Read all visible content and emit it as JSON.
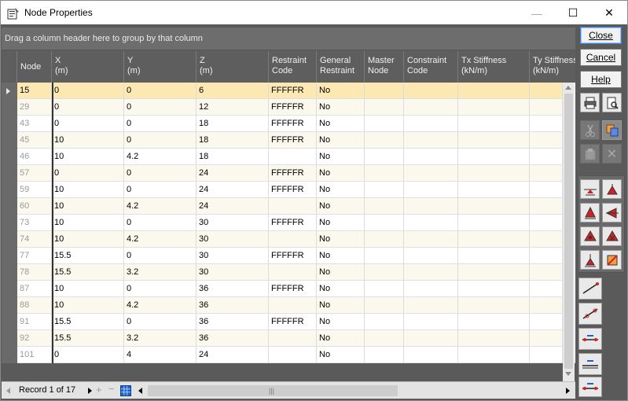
{
  "window": {
    "title": "Node Properties",
    "minimize_glyph": "—",
    "maximize_glyph": "☐",
    "close_glyph": "✕"
  },
  "grid": {
    "group_panel_text": "Drag a column header here to group by that column",
    "columns": [
      {
        "label": "Node",
        "unit": ""
      },
      {
        "label": "X",
        "unit": "(m)"
      },
      {
        "label": "Y",
        "unit": "(m)"
      },
      {
        "label": "Z",
        "unit": "(m)"
      },
      {
        "label": "Restraint",
        "unit": "Code"
      },
      {
        "label": "General",
        "unit": "Restraint"
      },
      {
        "label": "Master",
        "unit": "Node"
      },
      {
        "label": "Constraint",
        "unit": "Code"
      },
      {
        "label": "Tx Stiffness",
        "unit": "(kN/m)"
      },
      {
        "label": "Ty Stiffness",
        "unit": "(kN/m)"
      }
    ],
    "rows": [
      {
        "node": "15",
        "x": "0",
        "y": "0",
        "z": "6",
        "restraint": "FFFFFR",
        "general": "No"
      },
      {
        "node": "29",
        "x": "0",
        "y": "0",
        "z": "12",
        "restraint": "FFFFFR",
        "general": "No"
      },
      {
        "node": "43",
        "x": "0",
        "y": "0",
        "z": "18",
        "restraint": "FFFFFR",
        "general": "No"
      },
      {
        "node": "45",
        "x": "10",
        "y": "0",
        "z": "18",
        "restraint": "FFFFFR",
        "general": "No"
      },
      {
        "node": "46",
        "x": "10",
        "y": "4.2",
        "z": "18",
        "restraint": "",
        "general": "No"
      },
      {
        "node": "57",
        "x": "0",
        "y": "0",
        "z": "24",
        "restraint": "FFFFFR",
        "general": "No"
      },
      {
        "node": "59",
        "x": "10",
        "y": "0",
        "z": "24",
        "restraint": "FFFFFR",
        "general": "No"
      },
      {
        "node": "60",
        "x": "10",
        "y": "4.2",
        "z": "24",
        "restraint": "",
        "general": "No"
      },
      {
        "node": "73",
        "x": "10",
        "y": "0",
        "z": "30",
        "restraint": "FFFFFR",
        "general": "No"
      },
      {
        "node": "74",
        "x": "10",
        "y": "4.2",
        "z": "30",
        "restraint": "",
        "general": "No"
      },
      {
        "node": "77",
        "x": "15.5",
        "y": "0",
        "z": "30",
        "restraint": "FFFFFR",
        "general": "No"
      },
      {
        "node": "78",
        "x": "15.5",
        "y": "3.2",
        "z": "30",
        "restraint": "",
        "general": "No"
      },
      {
        "node": "87",
        "x": "10",
        "y": "0",
        "z": "36",
        "restraint": "FFFFFR",
        "general": "No"
      },
      {
        "node": "88",
        "x": "10",
        "y": "4.2",
        "z": "36",
        "restraint": "",
        "general": "No"
      },
      {
        "node": "91",
        "x": "15.5",
        "y": "0",
        "z": "36",
        "restraint": "FFFFFR",
        "general": "No"
      },
      {
        "node": "92",
        "x": "15.5",
        "y": "3.2",
        "z": "36",
        "restraint": "",
        "general": "No"
      },
      {
        "node": "101",
        "x": "0",
        "y": "4",
        "z": "24",
        "restraint": "",
        "general": "No"
      }
    ]
  },
  "navigator": {
    "record_text": "Record 1 of 17",
    "plus_glyph": "+",
    "minus_glyph": "−",
    "grip_glyph": "|||"
  },
  "toolbar": {
    "close_label": "Close",
    "cancel_label": "Cancel",
    "help_label": "Help",
    "delete_glyph": "✕",
    "icons": [
      "print-icon",
      "print-preview-icon",
      "cut-icon",
      "copy-icon",
      "paste-icon",
      "delete-icon",
      "pin-support-icon",
      "fixed-support-icon",
      "roller-support-icon",
      "side-support-icon",
      "triangle-support-icon",
      "triangle-x-support-icon",
      "spring-support-icon",
      "crossed-support-icon",
      "member-line-icon",
      "member-release-icon",
      "xy-constraint-icon",
      "xy-plane-icon",
      "xz-plane-icon"
    ]
  },
  "colors": {
    "selected_row": "#fce8b2",
    "alt_row": "#fbf8ee",
    "header_bg": "#5e5e5e",
    "support_red": "#d42020"
  }
}
